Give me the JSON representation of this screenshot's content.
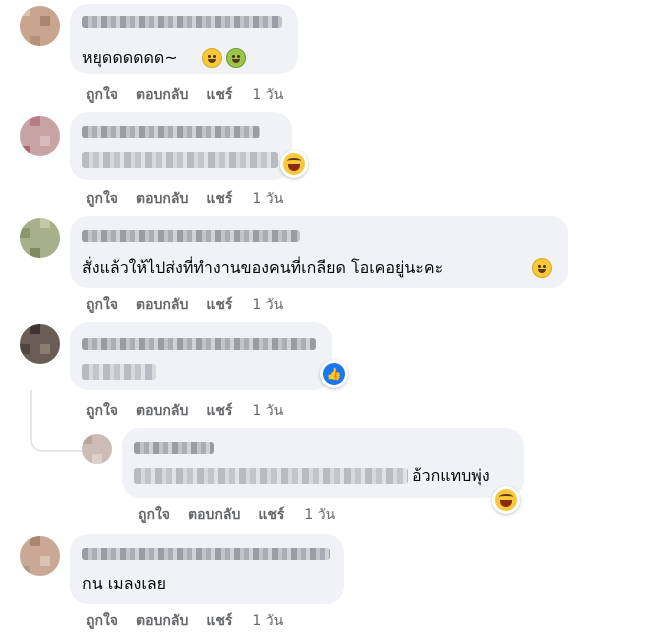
{
  "actions": {
    "like": "ถูกใจ",
    "reply": "ตอบกลับ",
    "share": "แชร์",
    "time": "1 วัน"
  },
  "comments": [
    {
      "text": "หยุดดดดดด~",
      "emojis": [
        "sweat-smile-emoji",
        "nauseated-emoji"
      ]
    },
    {
      "text": "",
      "reaction": "laugh-reaction-icon"
    },
    {
      "text": "สั่งแล้วให้ไปส่งที่ทำงานของคนที่เกลียด โอเคอยู่นะคะ",
      "emojis": [
        "grinning-sweat-emoji"
      ]
    },
    {
      "text": "",
      "reaction": "like-reaction-icon"
    },
    {
      "text": "อ้วกแทบพุ่ง",
      "reaction": "laugh-reaction-icon"
    },
    {
      "text": "กน เมลงเลย"
    }
  ],
  "colors": {
    "bubble": "#f0f2f5",
    "action": "#65676b",
    "like_blue": "#1877f2"
  }
}
